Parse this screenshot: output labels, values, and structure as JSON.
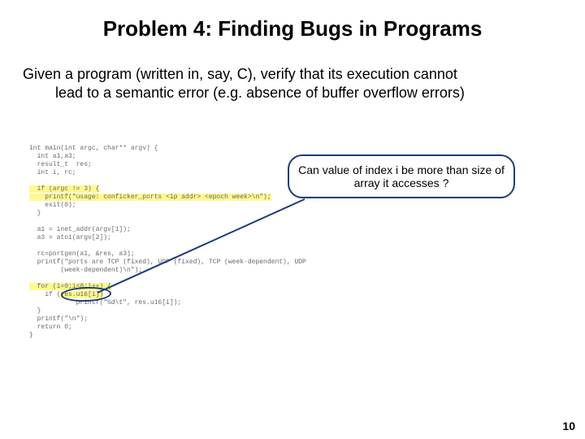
{
  "title": "Problem 4: Finding Bugs in Programs",
  "body": {
    "line1": "Given a program (written in, say, C), verify that its execution cannot",
    "line2": "lead to a semantic error (e.g. absence of buffer overflow errors)"
  },
  "code": {
    "l1": "int main(int argc, char** argv) {",
    "l2": "  int a1,a3;",
    "l3": "  result_t  res;",
    "l4": "  int i, rc;",
    "l5": "",
    "l6": "  if (argc != 3) {",
    "l7": "    printf(\"usage: conficker_ports <ip addr> <epoch week>\\n\");",
    "l8": "    exit(0);",
    "l9": "  }",
    "l10": "",
    "l11": "  a1 = inet_addr(argv[1]);",
    "l12": "  a3 = atoi(argv[2]);",
    "l13": "",
    "l14": "  rc=portgen(a1, &res, a3);",
    "l15": "  printf(\"ports are TCP (fixed), UDP (fixed), TCP (week-dependent), UDP",
    "l16": "        (week-dependent)\\n\");",
    "l17": "",
    "l18": "  for (i=0;i<8;i++) {",
    "l19a": "    if (",
    "l19b": "res.u16[i])",
    "l20": "            printf(\"%d\\t\", res.u16[i]);",
    "l21": "  }",
    "l22": "  printf(\"\\n\");",
    "l23": "  return 0;",
    "l24": "}"
  },
  "callout_text": "Can value of index i be more than size of array it accesses ?",
  "page_number": "10"
}
